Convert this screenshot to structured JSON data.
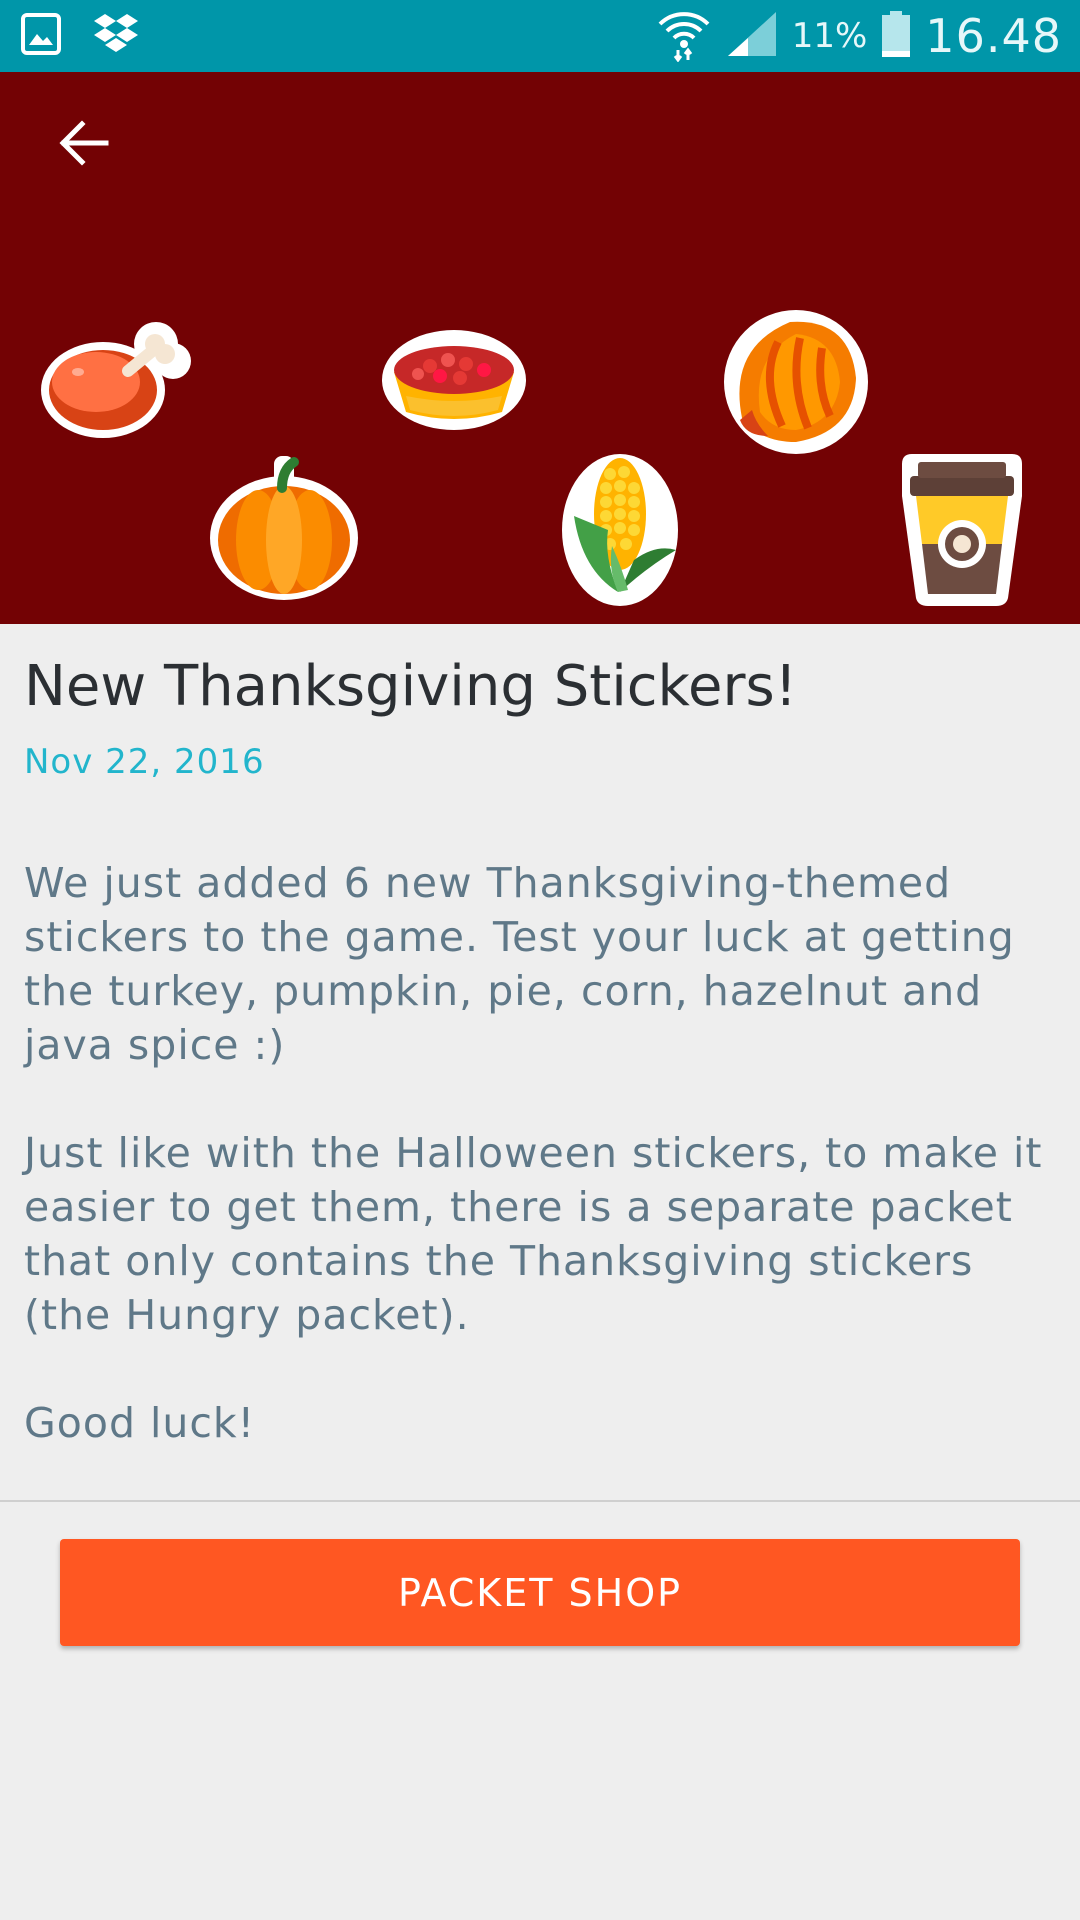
{
  "status_bar": {
    "battery_percent": "11%",
    "time": "16.48",
    "icons": [
      "gallery-icon",
      "dropbox-icon",
      "wifi-icon",
      "signal-icon",
      "battery-icon"
    ]
  },
  "header": {
    "back_icon": "arrow-left-icon",
    "background_color": "#730204",
    "stickers": [
      "turkey",
      "pumpkin",
      "pie",
      "corn",
      "hazelnut",
      "java-spice-cup"
    ]
  },
  "article": {
    "title": "New Thanksgiving Stickers!",
    "date": "Nov 22, 2016",
    "paragraphs": [
      "We just added 6 new Thanksgiving-themed stickers to the game. Test your luck at getting the turkey, pumpkin, pie, corn, hazelnut and java spice :)",
      "Just like with the Halloween stickers, to make it easier to get them, there is a separate packet that only contains the Thanksgiving stickers (the Hungry packet).",
      "Good luck!"
    ]
  },
  "actions": {
    "shop_button_label": "PACKET SHOP"
  },
  "colors": {
    "status_bar": "#0096a9",
    "accent": "#22b5cc",
    "button": "#ff5722",
    "background": "#eeeeee"
  }
}
